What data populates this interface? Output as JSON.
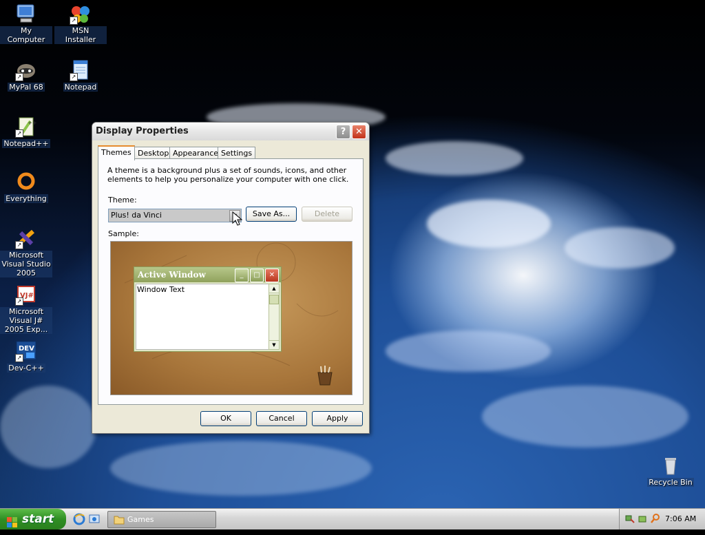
{
  "desktop": {
    "icons": [
      {
        "label": "My Computer",
        "icon": "my-computer-icon"
      },
      {
        "label": "MSN Installer",
        "icon": "msn-butterfly-icon"
      },
      {
        "label": "MyPal 68",
        "icon": "mypal-raccoon-icon"
      },
      {
        "label": "Notepad",
        "icon": "notepad-icon"
      },
      {
        "label": "Notepad++",
        "icon": "notepad-plus-plus-icon"
      },
      {
        "label": "Everything",
        "icon": "everything-search-icon"
      },
      {
        "label": "Microsoft Visual Studio 2005",
        "icon": "visual-studio-icon"
      },
      {
        "label": "Microsoft Visual J# 2005 Exp...",
        "icon": "visual-jsharp-icon"
      },
      {
        "label": "Dev-C++",
        "icon": "dev-cpp-icon"
      },
      {
        "label": "Recycle Bin",
        "icon": "recycle-bin-icon"
      }
    ]
  },
  "dialog": {
    "title": "Display Properties",
    "help_btn": "?",
    "close_btn": "✕",
    "tabs": [
      "Themes",
      "Desktop",
      "Appearance",
      "Settings"
    ],
    "description": "A theme is a background plus a set of sounds, icons, and other elements to help you personalize your computer with one click.",
    "theme_label": "Theme:",
    "theme_value": "Plus! da Vinci",
    "save_as": "Save As...",
    "delete": "Delete",
    "sample_label": "Sample:",
    "sample": {
      "window_title": "Active Window",
      "window_text": "Window Text"
    },
    "ok": "OK",
    "cancel": "Cancel",
    "apply": "Apply"
  },
  "taskbar": {
    "start": "start",
    "tasks": [
      "Games"
    ],
    "clock": "7:06 AM"
  },
  "colors": {
    "taskbar": "#c6c6c6",
    "start_button": "#2f8f23",
    "dialog_face": "#ece9d8",
    "active_tab_accent": "#e68b2c"
  }
}
